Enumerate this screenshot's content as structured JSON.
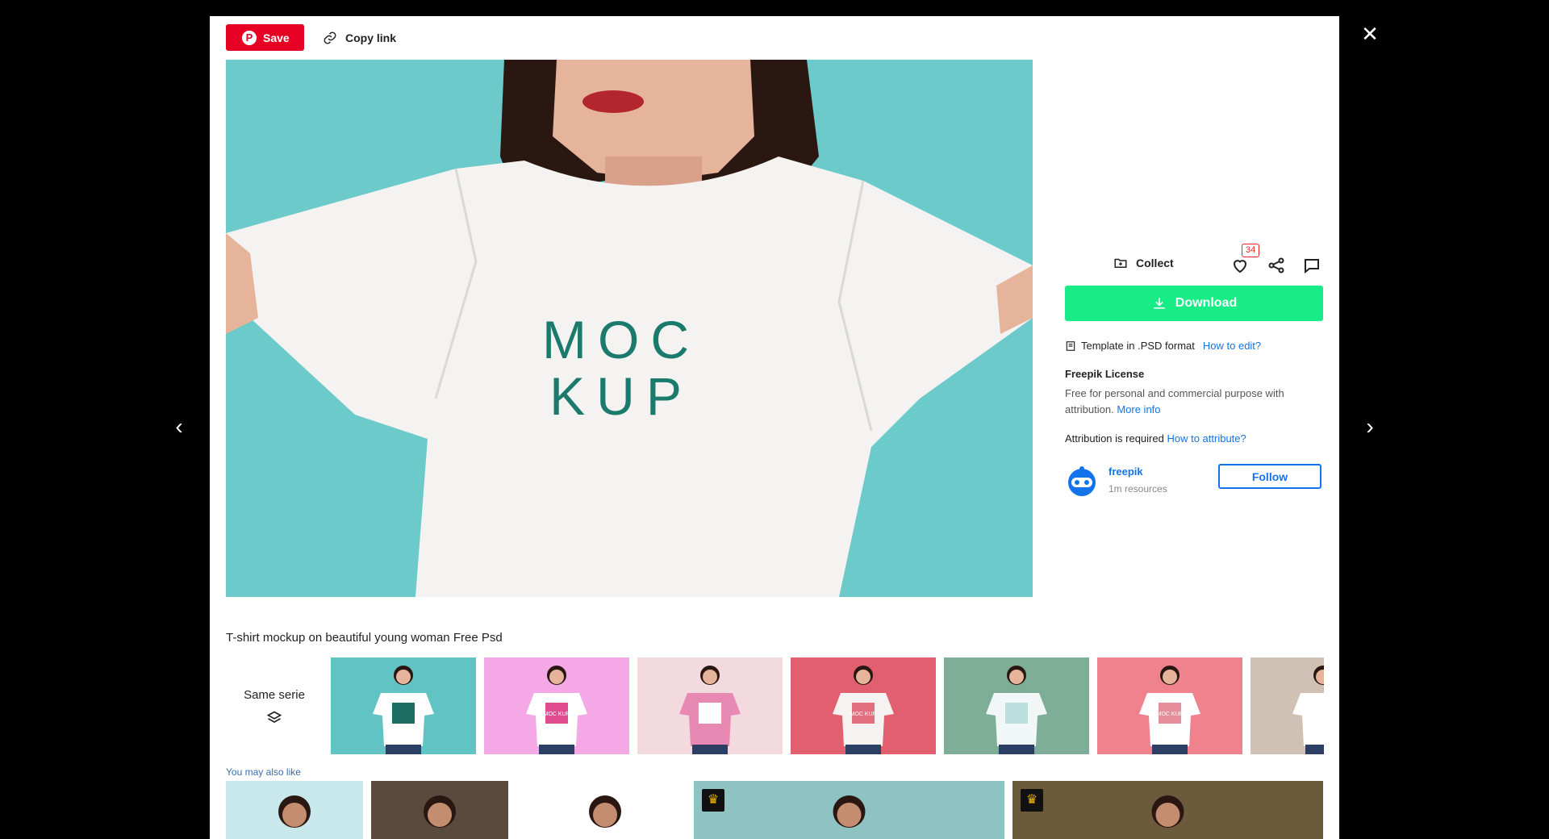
{
  "pinterest": {
    "save_label": "Save",
    "icon": "pinterest-icon",
    "color": "#e60023"
  },
  "copy_link": {
    "label": "Copy link",
    "icon": "link-icon"
  },
  "preview": {
    "shirt_print_line1": "MOC",
    "shirt_print_line2": "KUP"
  },
  "actions": {
    "collect_label": "Collect",
    "like_count": "34",
    "icons": [
      "collect-folder-icon",
      "heart-icon",
      "share-icon",
      "comment-icon"
    ]
  },
  "download": {
    "label": "Download",
    "color": "#18ec86"
  },
  "format": {
    "text": "Template in .PSD format",
    "link": "How to edit?"
  },
  "license": {
    "title": "Freepik License",
    "text": "Free for personal and commercial purpose with attribution.",
    "more": "More info"
  },
  "attribution": {
    "text": "Attribution is required",
    "link": "How to attribute?"
  },
  "author": {
    "name": "freepik",
    "resources": "1m resources",
    "follow_label": "Follow"
  },
  "resource_title": "T-shirt mockup on beautiful young woman Free Psd",
  "same_serie": {
    "label": "Same serie",
    "icon": "layers-icon"
  },
  "serie_thumbs": [
    {
      "bg": "#62c3c4",
      "shirt": "#ffffff",
      "print": "#1d6e62",
      "label": ""
    },
    {
      "bg": "#f4a8e6",
      "shirt": "#ffffff",
      "print": "#e24b8f",
      "label": "MOC KUP"
    },
    {
      "bg": "#f2dadf",
      "shirt": "#e889b4",
      "print": "#ffffff",
      "label": ""
    },
    {
      "bg": "#e25f6f",
      "shirt": "#f7f2f2",
      "print": "#e26e7e",
      "label": "MOC KUP"
    },
    {
      "bg": "#7fae98",
      "shirt": "#f1f7f6",
      "print": "#bcdedc",
      "label": ""
    },
    {
      "bg": "#f0828e",
      "shirt": "#ffffff",
      "print": "#e88e9a",
      "label": "MOC KUP"
    },
    {
      "bg": "#cfc2b4",
      "shirt": "#ffffff",
      "print": "#ffffff",
      "label": ""
    }
  ],
  "you_may_also_like": "You may also like",
  "related": [
    {
      "bg": "#c9e8ec",
      "premium": false
    },
    {
      "bg": "#5a4a3e",
      "premium": false
    },
    {
      "bg": "#ffffff",
      "premium": false
    },
    {
      "bg": "#8fc2c2",
      "premium": true
    },
    {
      "bg": "#6b5a3c",
      "premium": true
    }
  ]
}
